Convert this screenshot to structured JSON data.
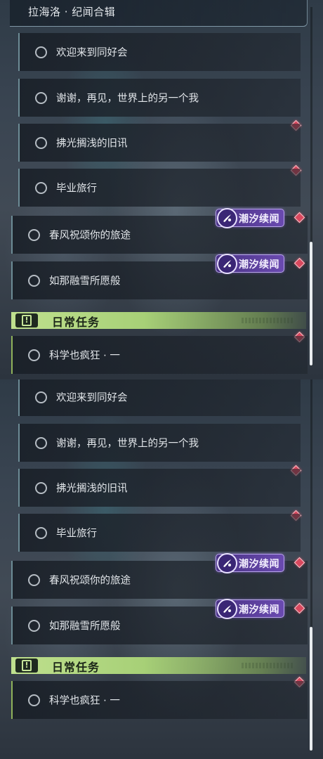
{
  "header": {
    "title": "拉海洛 · 纪闻合辑"
  },
  "quests": [
    {
      "label": "欢迎来到同好会"
    },
    {
      "label": "谢谢，再见，世界上的另一个我"
    },
    {
      "label": "拂光搁浅的旧讯"
    },
    {
      "label": "毕业旅行"
    },
    {
      "label": "春风祝颂你的旅途"
    },
    {
      "label": "如那融雪所愿般"
    }
  ],
  "badge": {
    "label": "潮汐续闻",
    "icon": "tide-swirl-icon"
  },
  "daily": {
    "title": "日常任务",
    "icon": "alert-icon",
    "quests": [
      {
        "label": "科学也疯狂 · 一"
      }
    ]
  },
  "colors": {
    "marker": "#d9485e",
    "badge": "#5b3f9d",
    "daily_accent": "#b5d985",
    "scroll_thumb": "#e8ecef"
  }
}
